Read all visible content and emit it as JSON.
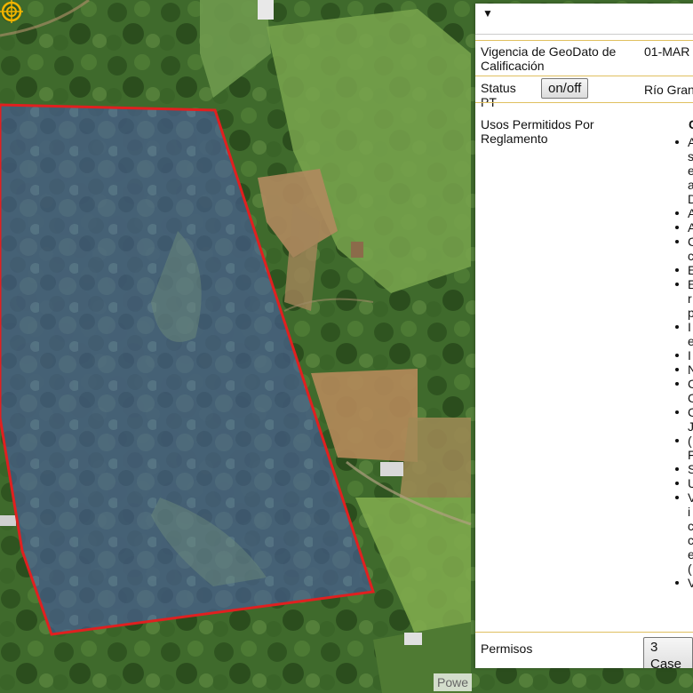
{
  "map": {
    "attribution": "Powe",
    "parcel_outline_color": "#e02020",
    "parcel_fill_color": "#5a6aa8",
    "marker_icon": "crosshair-target-icon",
    "marker_color": "#f0b400"
  },
  "panel": {
    "toggle_icon": "caret-down-icon",
    "vigencia_label": "Vigencia de GeoDato de Calificación",
    "vigencia_value": "01-MAR",
    "status_label": "Status PT",
    "status_button": "on/off",
    "status_value": "Río Gran",
    "usos_label": "Usos Permitidos Por Reglamento",
    "usos_heading_fragment": "C",
    "usos_items": [
      "A",
      "s",
      "e",
      "a",
      "D",
      "A",
      "A",
      "C",
      "c",
      "E",
      "E",
      "r",
      "p",
      "I",
      "e",
      "I",
      "N",
      "C",
      "C",
      "C",
      "J",
      "(",
      "F",
      "S",
      "U",
      "V",
      "i",
      "c",
      "c",
      "e",
      "(",
      "V"
    ],
    "usos_bullets": [
      true,
      false,
      false,
      false,
      false,
      true,
      true,
      true,
      false,
      true,
      true,
      false,
      false,
      true,
      false,
      true,
      true,
      true,
      false,
      true,
      false,
      true,
      false,
      true,
      true,
      true,
      false,
      false,
      false,
      false,
      false,
      true
    ],
    "permisos_label": "Permisos",
    "permisos_button": "3 Case"
  }
}
